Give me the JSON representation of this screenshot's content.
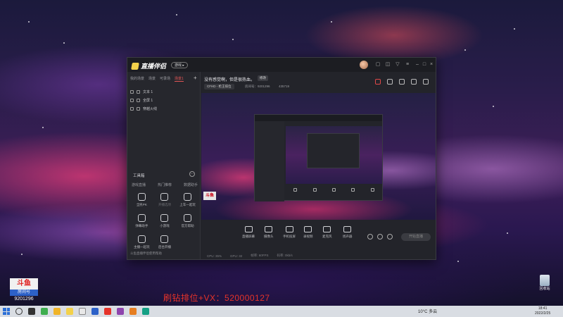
{
  "window": {
    "app_name": "直播伴侣",
    "version_badge": "游戏 ▸",
    "scene_tabs": [
      "我的场景",
      "场景",
      "可录场",
      "场景1"
    ],
    "add_scene": "+",
    "sources": [
      "文本 1",
      "全屏 1",
      "穿越火线"
    ],
    "tools_title": "工具箱",
    "tools_more": "···",
    "tool_tabs": [
      "游戏直播",
      "热门推荐",
      "数据助手"
    ],
    "tools": [
      {
        "label": "全民PK",
        "dim": false
      },
      {
        "label": "开播选项",
        "dim": true
      },
      {
        "label": "上车一起玩",
        "dim": false
      },
      {
        "label": "弹幕助手",
        "dim": false
      },
      {
        "label": "小游戏",
        "dim": false
      },
      {
        "label": "官方帮助",
        "dim": false
      },
      {
        "label": "主播一起玩",
        "dim": false
      },
      {
        "label": "后台开播",
        "dim": false
      }
    ],
    "notice": "斗鱼直播伴侣使用帮助",
    "room_title": "没有感觉啊，但是很热血。",
    "edit_label": "修改",
    "category": "CFHD - 枪王排位",
    "room_id": "房间号：9201296",
    "heat": "435719",
    "controls": [
      "直播屏幕",
      "摄像头",
      "手机投屏",
      "录视频",
      "麦克风",
      "扬声器"
    ],
    "live_button": "开始直播",
    "status": [
      "CPU: 35%",
      "GPU: 32",
      "帧率: 60FPS",
      "码率: 0kb/s"
    ]
  },
  "overlay": {
    "douyu_logo": "斗鱼",
    "douyu_sub": "房间号",
    "douyu_room": "9201296",
    "promo_text": "刷钻排位+VX：520000127",
    "recycle_label": "回收站"
  },
  "taskbar": {
    "weather": "10°C 多云",
    "time": "18:41",
    "date": "2022/2/25"
  }
}
